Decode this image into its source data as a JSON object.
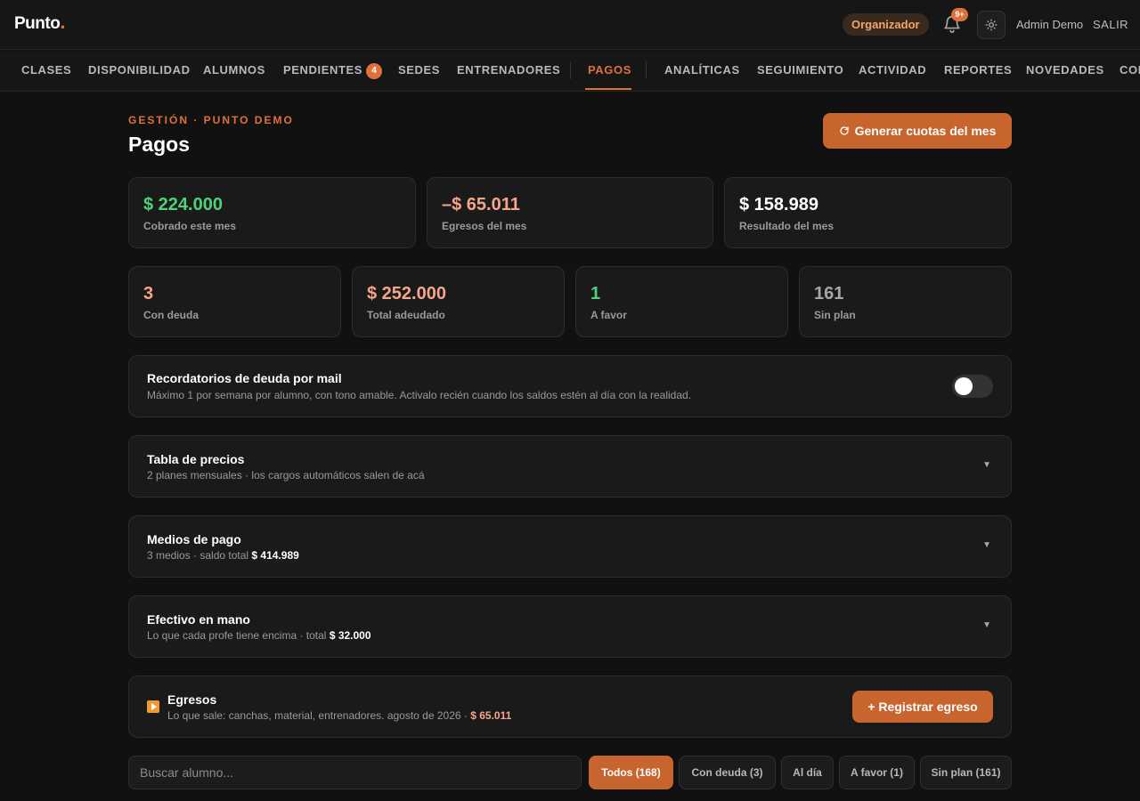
{
  "header": {
    "logo": "Punto",
    "logo_dot": ".",
    "role": "Organizador",
    "notifications_badge": "9+",
    "user": "Admin Demo",
    "logout": "SALIR"
  },
  "nav": {
    "items": [
      {
        "label": "CLASES"
      },
      {
        "label": "DISPONIBILIDAD"
      },
      {
        "label": "ALUMNOS"
      },
      {
        "label": "PENDIENTES",
        "count": "4"
      },
      {
        "label": "SEDES"
      },
      {
        "label": "ENTRENADORES"
      },
      {
        "label": "PAGOS"
      },
      {
        "label": "ANALÍTICAS"
      },
      {
        "label": "SEGUIMIENTO"
      },
      {
        "label": "ACTIVIDAD"
      },
      {
        "label": "REPORTES"
      },
      {
        "label": "NOVEDADES"
      },
      {
        "label": "CON"
      }
    ],
    "active": "PAGOS"
  },
  "page": {
    "eyebrow": "GESTIÓN · PUNTO DEMO",
    "title": "Pagos",
    "generate_button": "Generar cuotas del mes"
  },
  "summary": [
    {
      "value": "$ 224.000",
      "label": "Cobrado este mes"
    },
    {
      "value": "–$ 65.011",
      "label": "Egresos del mes"
    },
    {
      "value": "$ 158.989",
      "label": "Resultado del mes"
    }
  ],
  "status": [
    {
      "value": "3",
      "label": "Con deuda"
    },
    {
      "value": "$ 252.000",
      "label": "Total adeudado"
    },
    {
      "value": "1",
      "label": "A favor"
    },
    {
      "value": "161",
      "label": "Sin plan"
    }
  ],
  "reminders": {
    "title": "Recordatorios de deuda por mail",
    "subtitle": "Máximo 1 por semana por alumno, con tono amable. Activalo recién cuando los saldos estén al día con la realidad.",
    "enabled": false
  },
  "prices": {
    "title": "Tabla de precios",
    "subtitle": "2 planes mensuales · los cargos automáticos salen de acá"
  },
  "payment_methods": {
    "title": "Medios de pago",
    "subtitle": "3 medios · saldo total",
    "total": "$ 414.989"
  },
  "cash": {
    "title": "Efectivo en mano",
    "subtitle": "Lo que cada profe tiene encima · total",
    "total": "$ 32.000"
  },
  "expenses": {
    "title": "Egresos",
    "subtitle": "Lo que sale: canchas, material, entrenadores. agosto de 2026 ·",
    "total": "$ 65.011",
    "button": "+ Registrar egreso"
  },
  "search": {
    "placeholder": "Buscar alumno..."
  },
  "filters": [
    {
      "label": "Todos (168)"
    },
    {
      "label": "Con deuda (3)"
    },
    {
      "label": "Al día"
    },
    {
      "label": "A favor (1)"
    },
    {
      "label": "Sin plan (161)"
    }
  ],
  "colors": {
    "accent": "#e0703a",
    "positive": "#4fd17a",
    "negative": "#f5a58a"
  }
}
